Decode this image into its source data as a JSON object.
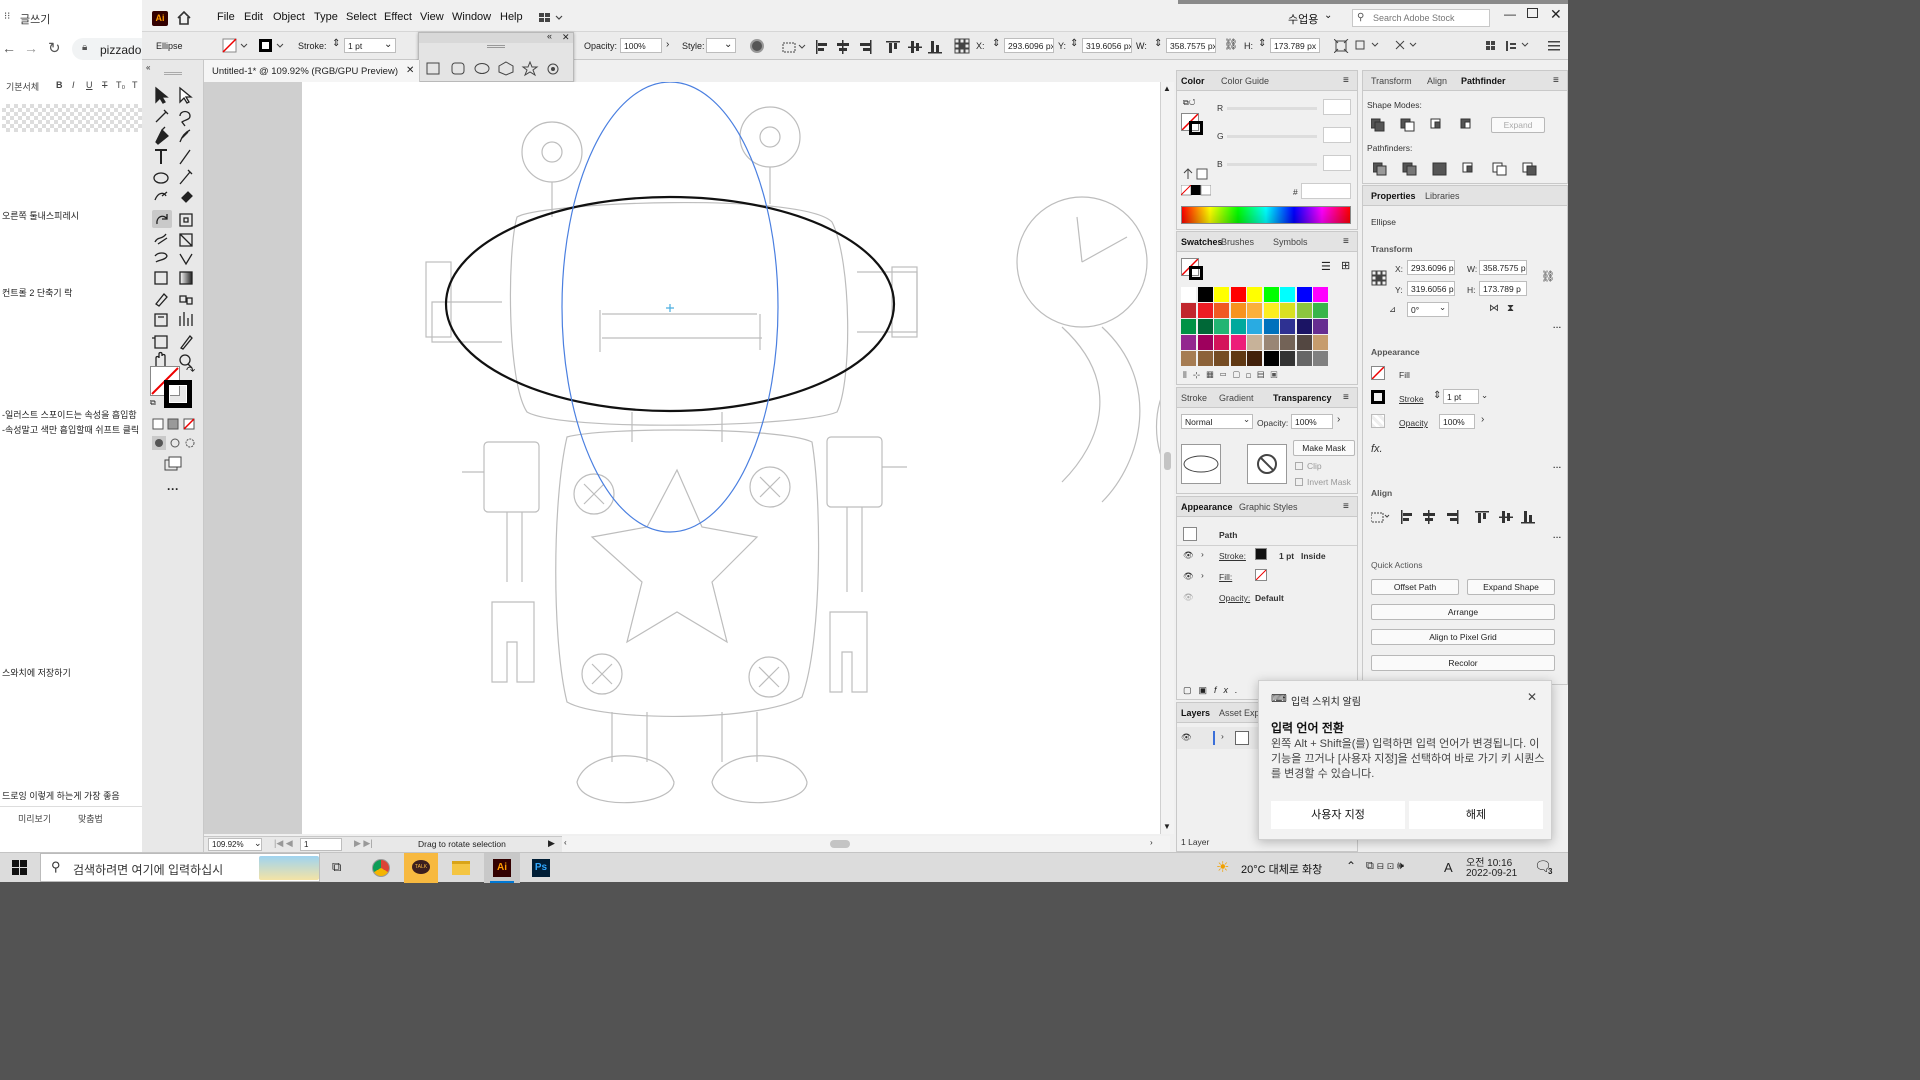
{
  "blog": {
    "tab_title": "글쓰기",
    "url_text": "pizzado",
    "editor_label": "기본서체",
    "editor_buttons": [
      "B",
      "I",
      "U",
      "T",
      "T₀",
      "T"
    ],
    "notes": [
      "오른쪽 툴내스피레시",
      "컨트롤 2 단축기 락",
      "-일러스트 스포이드는 속성을 흡입함",
      "-속성말고 색만 흡입할때 쉬프트 클릭",
      "스와치에 저장하기",
      "드로잉 이렇게 하는게 가장 좋음"
    ],
    "bottom_buttons": [
      "미리보기",
      "맞춤법"
    ]
  },
  "menu": {
    "logo": "Ai",
    "items": [
      "File",
      "Edit",
      "Object",
      "Type",
      "Select",
      "Effect",
      "View",
      "Window",
      "Help"
    ],
    "workspace": "수업용",
    "search_placeholder": "Search Adobe Stock"
  },
  "control": {
    "object_type": "Ellipse",
    "stroke_label": "Stroke:",
    "stroke_value": "1 pt",
    "opacity_label": "Opacity:",
    "opacity_value": "100%",
    "style_label": "Style:",
    "x_label": "X:",
    "x_value": "293.6096 px",
    "y_label": "Y:",
    "y_value": "319.6056 px",
    "w_label": "W:",
    "w_value": "358.7575 px",
    "h_label": "H:",
    "h_value": "173.789 px"
  },
  "document": {
    "tab_title": "Untitled-1* @ 109.92% (RGB/GPU Preview)",
    "zoom": "109.92%",
    "artboard_num": "1",
    "status": "Drag to rotate selection"
  },
  "color_panel": {
    "tabs": [
      "Color",
      "Color Guide"
    ],
    "channels": [
      "R",
      "G",
      "B"
    ],
    "hash": "#"
  },
  "swatches_panel": {
    "tabs": [
      "Swatches",
      "Brushes",
      "Symbols"
    ],
    "rows": [
      [
        "#ffffff",
        "#000000",
        "#ffff00",
        "#ff0000",
        "#ffff00",
        "#00ff00",
        "#00ffff",
        "#0000ff",
        "#ff00ff"
      ],
      [
        "#c1272d",
        "#ed1c24",
        "#f15a24",
        "#f7931e",
        "#fbb03b",
        "#fcee21",
        "#d9e021",
        "#8cc63f",
        "#39b54a"
      ],
      [
        "#009245",
        "#006837",
        "#22b573",
        "#00a99d",
        "#29abe2",
        "#0071bc",
        "#2e3192",
        "#1b1464",
        "#662d91"
      ],
      [
        "#93278f",
        "#9e005d",
        "#d4145a",
        "#ed1e79",
        "#c7b299",
        "#998675",
        "#736357",
        "#534741",
        "#c69c6d"
      ],
      [
        "#a67c52",
        "#8c6239",
        "#754c24",
        "#603813",
        "#42210b",
        "#000000",
        "#333333",
        "#666666",
        "#808080"
      ]
    ]
  },
  "transparency_panel": {
    "tabs": [
      "Stroke",
      "Gradient",
      "Transparency"
    ],
    "mode": "Normal",
    "opacity_label": "Opacity:",
    "opacity_value": "100%",
    "make_mask": "Make Mask",
    "clip": "Clip",
    "invert_mask": "Invert Mask"
  },
  "appearance_panel": {
    "tabs": [
      "Appearance",
      "Graphic Styles"
    ],
    "object": "Path",
    "stroke_label": "Stroke:",
    "stroke_value": "1 pt",
    "stroke_align": "Inside",
    "fill_label": "Fill:",
    "opacity_label": "Opacity:",
    "opacity_value": "Default"
  },
  "layers_panel": {
    "tabs": [
      "Layers",
      "Asset Expo"
    ],
    "count": "1 Layer"
  },
  "right_panels": {
    "top_tabs": [
      "Transform",
      "Align",
      "Pathfinder"
    ],
    "shape_modes": "Shape Modes:",
    "expand": "Expand",
    "pathfinders": "Pathfinders:",
    "props_tabs": [
      "Properties",
      "Libraries"
    ],
    "object_type": "Ellipse",
    "transform_label": "Transform",
    "x_label": "X:",
    "x_value": "293.6096 p",
    "y_label": "Y:",
    "y_value": "319.6056 p",
    "w_label": "W:",
    "w_value": "358.7575 p",
    "h_label": "H:",
    "h_value": "173.789 p",
    "angle": "0°",
    "appearance_label": "Appearance",
    "fill": "Fill",
    "stroke": "Stroke",
    "stroke_value": "1 pt",
    "opacity": "Opacity",
    "opacity_value": "100%",
    "fx": "fx.",
    "align_label": "Align",
    "quick_actions": "Quick Actions",
    "offset_path": "Offset Path",
    "expand_shape": "Expand Shape",
    "arrange": "Arrange",
    "align_pixel": "Align to Pixel Grid",
    "recolor": "Recolor"
  },
  "toast": {
    "app": "입력 스위치 알림",
    "title": "입력 언어 전환",
    "body": "왼쪽 Alt + Shift을(를) 입력하면 입력 언어가 변경됩니다. 이 기능을 끄거나 [사용자 지정]을 선택하여 바로 가기 키 시퀀스를 변경할 수 있습니다.",
    "btn_customize": "사용자 지정",
    "btn_dismiss": "해제"
  },
  "taskbar": {
    "search_placeholder": "검색하려면 여기에 입력하십시",
    "weather": "20°C 대체로 화창",
    "ime": "A",
    "time_ampm": "오전 10:16",
    "date": "2022-09-21",
    "notif_count": "3"
  }
}
